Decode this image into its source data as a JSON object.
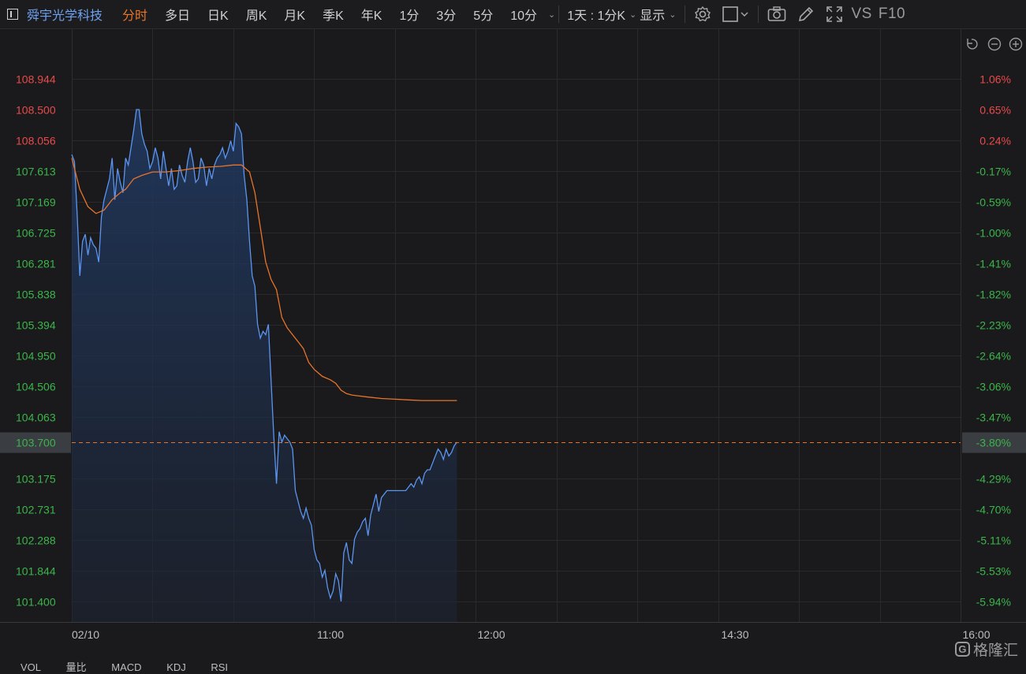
{
  "toolbar": {
    "stock_name": "舜宇光学科技",
    "tabs": [
      "分时",
      "多日",
      "日K",
      "周K",
      "月K",
      "季K",
      "年K",
      "1分",
      "3分",
      "5分",
      "10分"
    ],
    "active_tab": "分时",
    "period_label": "1天 : 1分K",
    "display_label": "显示",
    "vs_label": "VS",
    "f10_label": "F10"
  },
  "bottom_tabs": [
    "VOL",
    "量比",
    "MACD",
    "KDJ",
    "RSI"
  ],
  "logo_text": "格隆汇",
  "colors": {
    "price_line": "#5b95f0",
    "avg_line": "#e8742a",
    "up": "#e84a4a",
    "down": "#3bb54a",
    "current_price_bg": "#3a3d42"
  },
  "chart_data": {
    "type": "line",
    "date_label": "02/10",
    "x_tick_labels": [
      "02/10",
      "11:00",
      "12:00",
      "14:30",
      "16:00"
    ],
    "ylim": [
      101.4,
      108.944
    ],
    "y_ticks": [
      "108.944",
      "108.500",
      "108.056",
      "107.613",
      "107.169",
      "106.725",
      "106.281",
      "105.838",
      "105.394",
      "104.950",
      "104.506",
      "104.063",
      "103.700",
      "103.175",
      "102.731",
      "102.288",
      "101.844",
      "101.400"
    ],
    "y_tick_values": [
      108.944,
      108.5,
      108.056,
      107.613,
      107.169,
      106.725,
      106.281,
      105.838,
      105.394,
      104.95,
      104.506,
      104.063,
      103.7,
      103.175,
      102.731,
      102.288,
      101.844,
      101.4
    ],
    "pct_ticks": [
      "1.06%",
      "0.65%",
      "0.24%",
      "-0.17%",
      "-0.59%",
      "-1.00%",
      "-1.41%",
      "-1.82%",
      "-2.23%",
      "-2.64%",
      "-3.06%",
      "-3.47%",
      "-3.80%",
      "-4.29%",
      "-4.70%",
      "-5.11%",
      "-5.53%",
      "-5.94%"
    ],
    "current_price": 103.7,
    "current_pct": "-3.80%",
    "prev_close": 107.8,
    "x_start_minute": 0,
    "total_minutes": 330,
    "series": [
      {
        "key": "price",
        "minutes": [
          0,
          1,
          2,
          3,
          4,
          5,
          6,
          7,
          8,
          9,
          10,
          11,
          12,
          13,
          14,
          15,
          16,
          17,
          18,
          19,
          20,
          21,
          22,
          23,
          24,
          25,
          26,
          27,
          28,
          29,
          30,
          31,
          32,
          33,
          34,
          35,
          36,
          37,
          38,
          39,
          40,
          41,
          42,
          43,
          44,
          45,
          46,
          47,
          48,
          49,
          50,
          51,
          52,
          53,
          54,
          55,
          56,
          57,
          58,
          59,
          60,
          61,
          62,
          63,
          64,
          65,
          66,
          67,
          68,
          69,
          70,
          71,
          72,
          73,
          74,
          75,
          76,
          77,
          78,
          79,
          80,
          81,
          82,
          83,
          84,
          85,
          86,
          87,
          88,
          89,
          90,
          91,
          92,
          93,
          94,
          95,
          96,
          97,
          98,
          99,
          100,
          101,
          102,
          103,
          104,
          105,
          106,
          107,
          108,
          109,
          110,
          111,
          112,
          113,
          114,
          115,
          116,
          117,
          118,
          119,
          120,
          121,
          122,
          123,
          124,
          125,
          126,
          127,
          128,
          129,
          130,
          131,
          132,
          133,
          134,
          135,
          136,
          137,
          138,
          139,
          140,
          141,
          142,
          143
        ],
        "values": [
          107.85,
          107.75,
          107.0,
          106.1,
          106.6,
          106.7,
          106.4,
          106.65,
          106.55,
          106.5,
          106.3,
          106.95,
          107.2,
          107.35,
          107.5,
          107.8,
          107.2,
          107.65,
          107.45,
          107.3,
          107.8,
          107.7,
          107.95,
          108.2,
          108.5,
          108.5,
          108.15,
          108.0,
          107.9,
          107.65,
          107.75,
          107.95,
          107.8,
          107.5,
          107.9,
          107.65,
          107.4,
          107.65,
          107.35,
          107.4,
          107.7,
          107.55,
          107.45,
          107.75,
          107.95,
          107.75,
          107.45,
          107.5,
          107.8,
          107.7,
          107.4,
          107.65,
          107.5,
          107.7,
          107.8,
          107.85,
          107.95,
          107.8,
          107.9,
          108.05,
          107.9,
          108.3,
          108.25,
          108.15,
          107.55,
          107.2,
          106.6,
          106.1,
          105.95,
          105.4,
          105.2,
          105.3,
          105.25,
          105.4,
          104.6,
          103.8,
          103.1,
          103.85,
          103.7,
          103.8,
          103.75,
          103.7,
          103.6,
          103.0,
          102.85,
          102.7,
          102.6,
          102.75,
          102.6,
          102.5,
          102.15,
          102.0,
          101.95,
          101.75,
          101.85,
          101.6,
          101.45,
          101.55,
          101.8,
          101.7,
          101.4,
          102.1,
          102.25,
          102.0,
          101.95,
          102.3,
          102.4,
          102.45,
          102.55,
          102.6,
          102.35,
          102.65,
          102.8,
          102.95,
          102.7,
          102.9,
          102.95,
          103.0,
          103.0,
          103.0,
          103.0,
          103.0,
          103.0,
          103.0,
          103.0,
          103.05,
          103.1,
          103.05,
          103.15,
          103.2,
          103.1,
          103.25,
          103.3,
          103.3,
          103.4,
          103.5,
          103.6,
          103.55,
          103.45,
          103.6,
          103.5,
          103.55,
          103.65,
          103.7
        ]
      },
      {
        "key": "average",
        "minutes": [
          0,
          3,
          6,
          9,
          12,
          15,
          18,
          20,
          23,
          26,
          30,
          35,
          40,
          45,
          50,
          55,
          60,
          63,
          66,
          68,
          70,
          72,
          74,
          76,
          78,
          80,
          82,
          84,
          86,
          88,
          90,
          93,
          96,
          98,
          100,
          102,
          104,
          106,
          110,
          115,
          120,
          125,
          130,
          135,
          140,
          143
        ],
        "values": [
          107.8,
          107.35,
          107.1,
          107.0,
          107.05,
          107.2,
          107.3,
          107.35,
          107.5,
          107.55,
          107.6,
          107.6,
          107.62,
          107.65,
          107.67,
          107.68,
          107.7,
          107.7,
          107.6,
          107.3,
          106.8,
          106.3,
          106.05,
          105.9,
          105.5,
          105.35,
          105.25,
          105.15,
          105.05,
          104.85,
          104.75,
          104.65,
          104.6,
          104.55,
          104.45,
          104.4,
          104.38,
          104.37,
          104.35,
          104.33,
          104.32,
          104.31,
          104.3,
          104.3,
          104.3,
          104.3
        ]
      }
    ]
  }
}
